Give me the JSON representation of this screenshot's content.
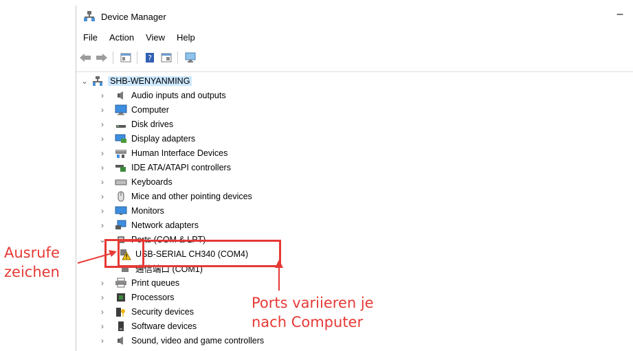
{
  "window": {
    "title": "Device Manager",
    "minimize_glyph": "–"
  },
  "menu": [
    "File",
    "Action",
    "View",
    "Help"
  ],
  "toolbar": [
    "back-icon",
    "forward-icon",
    "properties-icon",
    "help-icon",
    "update-driver-icon",
    "scan-hardware-icon"
  ],
  "tree": {
    "root": "SHB-WENYANMING",
    "categories": [
      {
        "label": "Audio inputs and outputs",
        "icon": "speaker-icon"
      },
      {
        "label": "Computer",
        "icon": "computer-icon"
      },
      {
        "label": "Disk drives",
        "icon": "disk-drive-icon"
      },
      {
        "label": "Display adapters",
        "icon": "display-adapter-icon"
      },
      {
        "label": "Human Interface Devices",
        "icon": "hid-icon"
      },
      {
        "label": "IDE ATA/ATAPI controllers",
        "icon": "ide-controller-icon"
      },
      {
        "label": "Keyboards",
        "icon": "keyboard-icon"
      },
      {
        "label": "Mice and other pointing devices",
        "icon": "mouse-icon"
      },
      {
        "label": "Monitors",
        "icon": "monitor-icon"
      },
      {
        "label": "Network adapters",
        "icon": "network-adapter-icon"
      },
      {
        "label": "Ports (COM & LPT)",
        "icon": "port-icon"
      },
      {
        "label": "Print queues",
        "icon": "printer-icon"
      },
      {
        "label": "Processors",
        "icon": "processor-icon"
      },
      {
        "label": "Security devices",
        "icon": "security-device-icon"
      },
      {
        "label": "Software devices",
        "icon": "software-device-icon"
      },
      {
        "label": "Sound, video and game controllers",
        "icon": "sound-controller-icon"
      }
    ],
    "ports_children": [
      {
        "label": "USB-SERIAL CH340 (COM4)",
        "icon": "warning-port-icon"
      },
      {
        "label": "通信端口 (COM1)",
        "icon": "port-icon"
      }
    ]
  },
  "annotations": {
    "left_label_line1": "Ausrufe",
    "left_label_line2": "zeichen",
    "right_label_line1": "Ports variieren je",
    "right_label_line2": "nach Computer",
    "color": "#e53935"
  }
}
